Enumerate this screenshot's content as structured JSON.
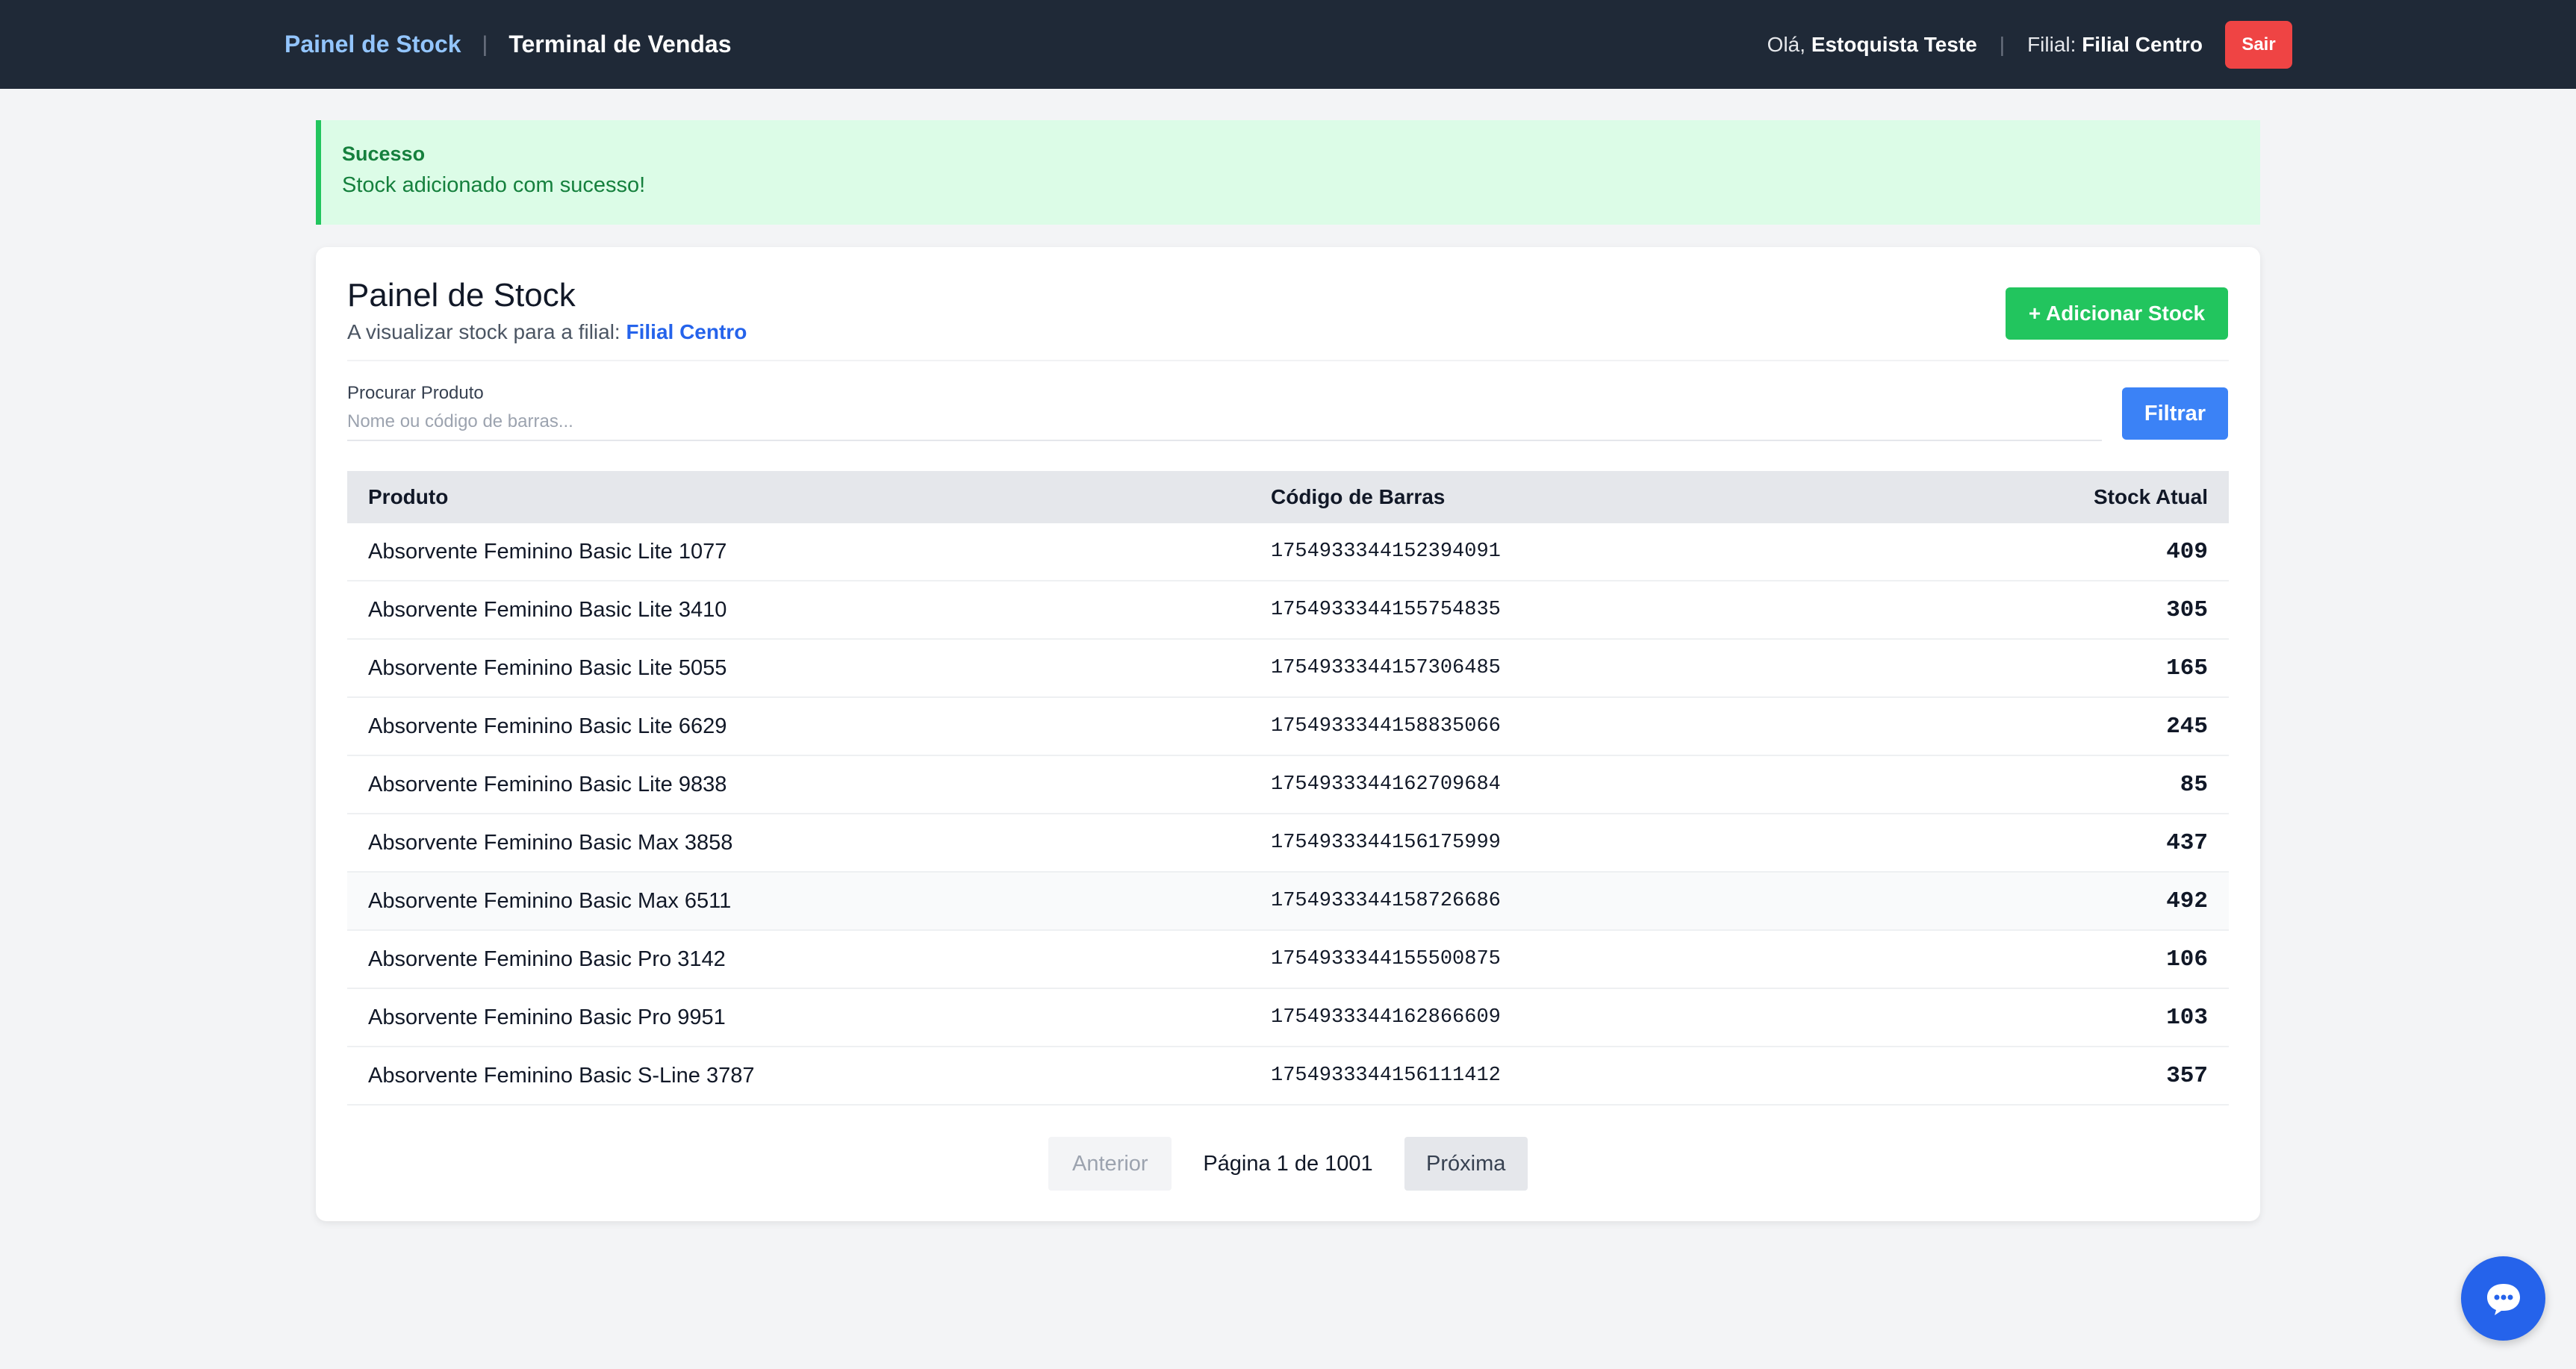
{
  "header": {
    "brand": "Painel de Stock",
    "separator": "|",
    "pos_link": "Terminal de Vendas",
    "greeting_prefix": "Olá, ",
    "user_name": "Estoquista Teste",
    "branch_prefix": "Filial: ",
    "branch_name": "Filial Centro",
    "logout_label": "Sair"
  },
  "alert": {
    "title": "Sucesso",
    "message": "Stock adicionado com sucesso!"
  },
  "panel": {
    "title": "Painel de Stock",
    "subtitle_prefix": "A visualizar stock para a filial: ",
    "branch_name": "Filial Centro",
    "add_button": "+ Adicionar Stock"
  },
  "search": {
    "label": "Procurar Produto",
    "placeholder": "Nome ou código de barras...",
    "value": "",
    "filter_button": "Filtrar"
  },
  "table": {
    "headers": [
      "Produto",
      "Código de Barras",
      "Stock Atual"
    ],
    "rows": [
      {
        "product": "Absorvente Feminino Basic Lite 1077",
        "barcode": "1754933344152394091",
        "stock": "409"
      },
      {
        "product": "Absorvente Feminino Basic Lite 3410",
        "barcode": "1754933344155754835",
        "stock": "305"
      },
      {
        "product": "Absorvente Feminino Basic Lite 5055",
        "barcode": "1754933344157306485",
        "stock": "165"
      },
      {
        "product": "Absorvente Feminino Basic Lite 6629",
        "barcode": "1754933344158835066",
        "stock": "245"
      },
      {
        "product": "Absorvente Feminino Basic Lite 9838",
        "barcode": "1754933344162709684",
        "stock": "85"
      },
      {
        "product": "Absorvente Feminino Basic Max 3858",
        "barcode": "1754933344156175999",
        "stock": "437"
      },
      {
        "product": "Absorvente Feminino Basic Max 6511",
        "barcode": "1754933344158726686",
        "stock": "492"
      },
      {
        "product": "Absorvente Feminino Basic Pro 3142",
        "barcode": "1754933344155500875",
        "stock": "106"
      },
      {
        "product": "Absorvente Feminino Basic Pro 9951",
        "barcode": "1754933344162866609",
        "stock": "103"
      },
      {
        "product": "Absorvente Feminino Basic S-Line 3787",
        "barcode": "1754933344156111412",
        "stock": "357"
      }
    ]
  },
  "pagination": {
    "prev_label": "Anterior",
    "info": "Página 1 de 1001",
    "next_label": "Próxima"
  },
  "fab": {
    "icon": "chat-bubble-icon"
  },
  "colors": {
    "header_bg": "#1f2937",
    "accent_blue": "#3b82f6",
    "success_green": "#22c55e",
    "danger_red": "#ef4444"
  }
}
